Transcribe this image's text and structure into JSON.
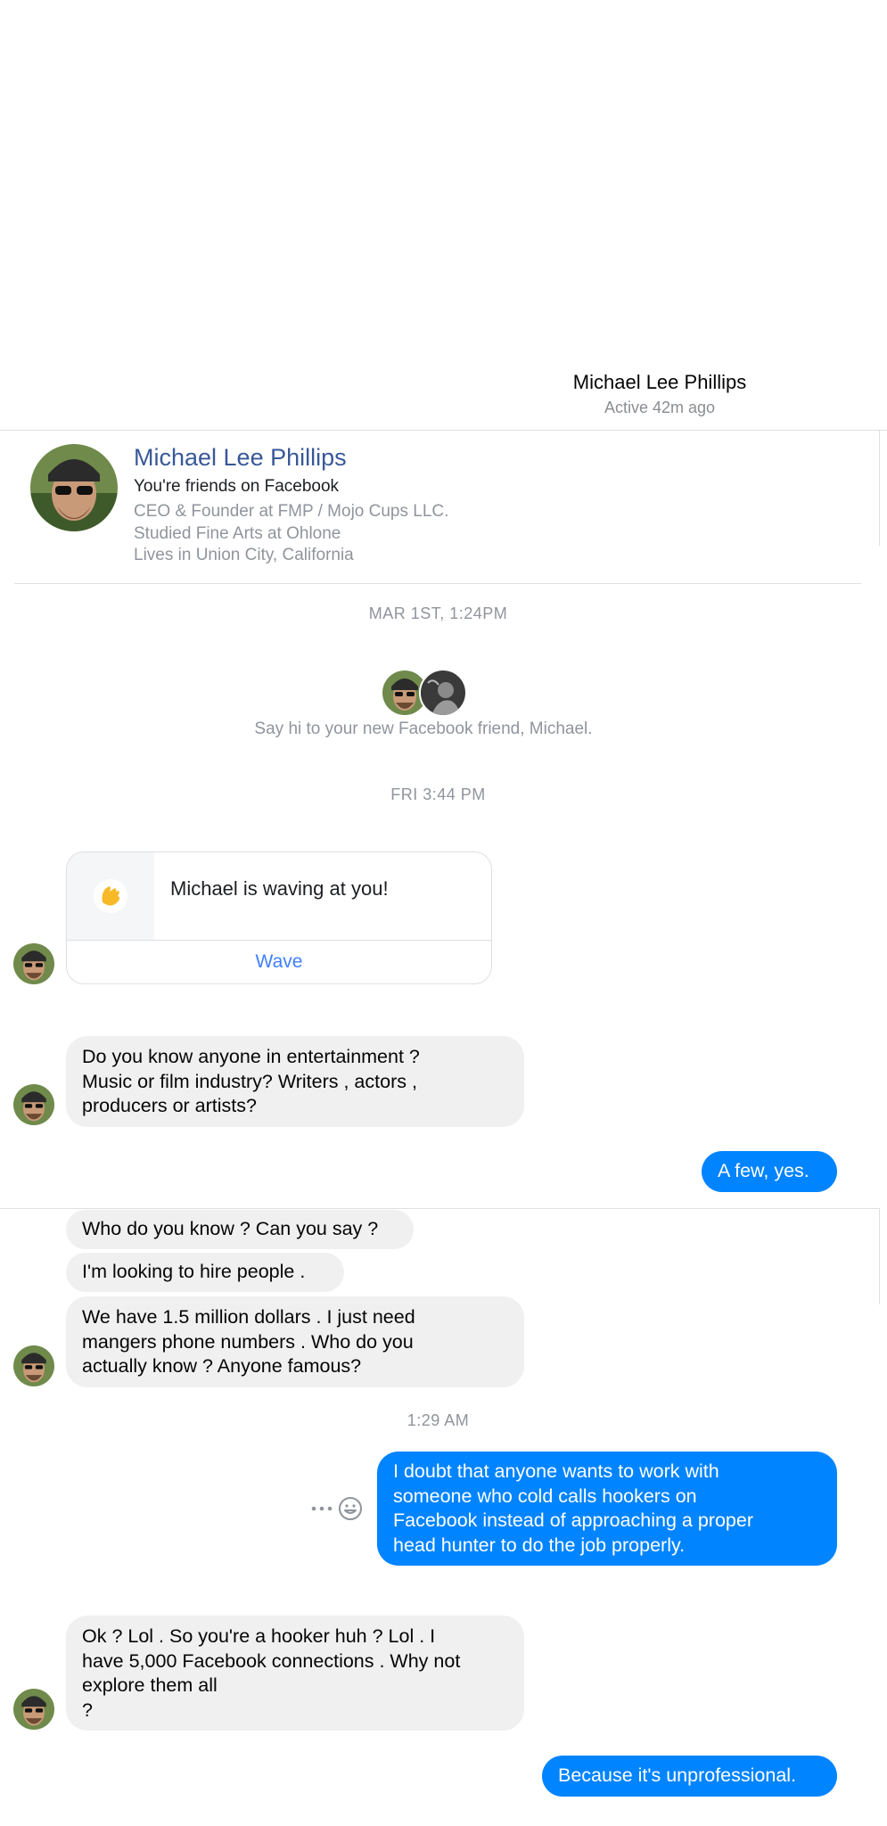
{
  "header": {
    "contact_name": "Michael Lee Phillips",
    "status": "Active 42m ago"
  },
  "profile": {
    "name": "Michael Lee Phillips",
    "friendship": "You're friends on Facebook",
    "work": "CEO & Founder at FMP / Mojo Cups LLC.",
    "education": "Studied Fine Arts at Ohlone",
    "location": "Lives in Union City, California"
  },
  "timeline": {
    "stamp1": "MAR 1ST, 1:24PM",
    "new_friend_text": "Say hi to your new Facebook friend, Michael.",
    "stamp2": "FRI 3:44 PM",
    "stamp3": "1:29 AM"
  },
  "wave_card": {
    "text": "Michael is waving at you!",
    "button_label": "Wave"
  },
  "messages": {
    "in1": [
      "Do you know anyone in entertainment ?",
      "Music or film industry? Writers , actors ,",
      "producers or artists?"
    ],
    "out1": [
      "A few, yes."
    ],
    "in2": [
      "Who do you know ? Can you say ?"
    ],
    "in3": [
      "I'm looking to hire people ."
    ],
    "in4": [
      "We have 1.5 million dollars . I just need",
      "mangers phone numbers . Who do you",
      "actually know ? Anyone famous?"
    ],
    "out2": [
      "I doubt that anyone wants to work with",
      "someone who cold calls hookers on",
      "Facebook instead of approaching a proper",
      "head hunter to do the job properly."
    ],
    "in5": [
      "Ok ? Lol . So you're a hooker huh ? Lol . I",
      "have 5,000 Facebook connections . Why not",
      "explore them all",
      "?"
    ],
    "out3": [
      "Because it's unprofessional."
    ]
  },
  "colors": {
    "outgoing_bubble": "#0084ff",
    "incoming_bubble": "#f0f0f0",
    "profile_link": "#385898",
    "wave_button": "#4080ff"
  },
  "icons": {
    "more": "more-icon",
    "emoji": "emoji-icon",
    "wave": "waving-hand-icon"
  }
}
